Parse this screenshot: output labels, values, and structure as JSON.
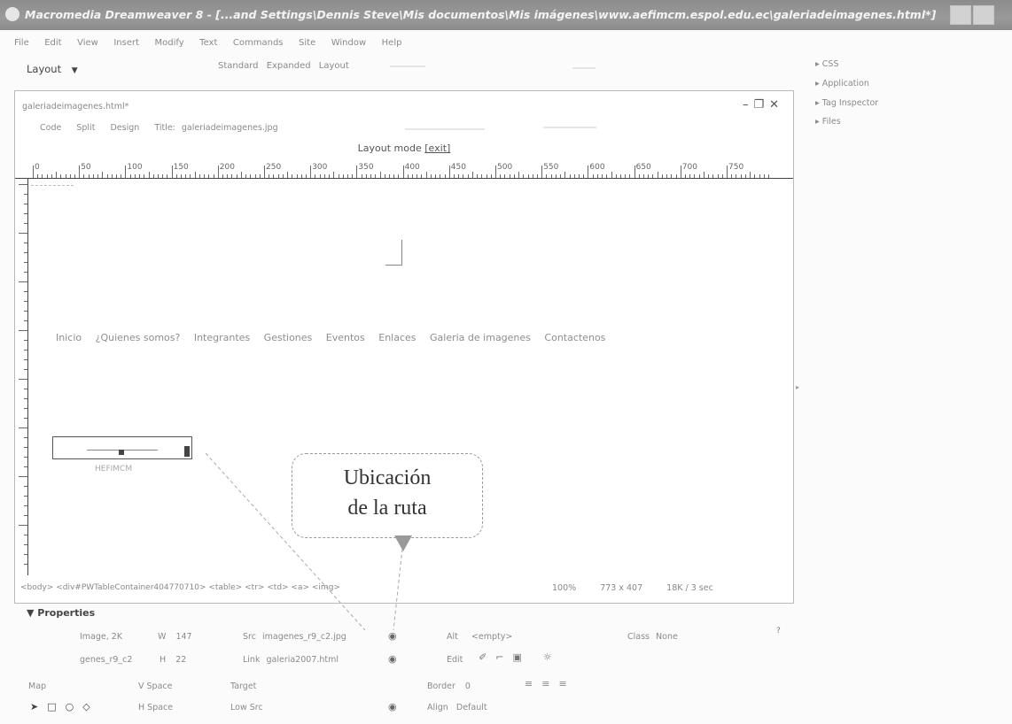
{
  "window": {
    "title": "Macromedia Dreamweaver 8 - [...and Settings\\Dennis Steve\\Mis documentos\\Mis imágenes\\www.aefimcm.espol.edu.ec\\galeriadeimagenes.html*]"
  },
  "menu": {
    "items": [
      "File",
      "Edit",
      "View",
      "Insert",
      "Modify",
      "Text",
      "Commands",
      "Site",
      "Window",
      "Help"
    ]
  },
  "toolbar": {
    "layout_dropdown": "Layout",
    "insert_tabs": [
      "Standard",
      "Expanded",
      "Layout"
    ]
  },
  "panels": {
    "items": [
      "CSS",
      "Application",
      "Tag Inspector",
      "Files"
    ]
  },
  "document": {
    "filename": "galeriadeimagenes.html*",
    "view_buttons": [
      "Code",
      "Split",
      "Design"
    ],
    "title_label": "Title:",
    "title_value": "galeriadeimagenes.jpg",
    "layout_mode_label": "Layout mode",
    "layout_mode_exit": "[exit]",
    "ruler_labels": [
      "0",
      "50",
      "100",
      "150",
      "200",
      "250",
      "300",
      "350",
      "400",
      "450",
      "500",
      "550",
      "600",
      "650",
      "700",
      "750"
    ],
    "nav_links": [
      "Inicio",
      "¿Quienes somos?",
      "Integrantes",
      "Gestiones",
      "Eventos",
      "Enlaces",
      "Galeria de imagenes",
      "Contactenos"
    ],
    "image_caption": "HEFIMCM",
    "callout": {
      "line1": "Ubicación",
      "line2": "de la ruta"
    },
    "tag_selector": "<body> <div#PWTableContainer404770710> <table> <tr> <td> <a> <img>",
    "zoom": "100%",
    "dimensions": "773 x 407",
    "filesize": "18K / 3 sec"
  },
  "properties": {
    "header": "Properties",
    "image_label": "Image, 2K",
    "image_name": "genes_r9_c2",
    "w_label": "W",
    "w_value": "147",
    "h_label": "H",
    "h_value": "22",
    "src_label": "Src",
    "src_value": "imagenes_r9_c2.jpg",
    "link_label": "Link",
    "link_value": "galeria2007.html",
    "alt_label": "Alt",
    "alt_value": "<empty>",
    "edit_label": "Edit",
    "class_label": "Class",
    "class_value": "None",
    "map_label": "Map",
    "vspace_label": "V Space",
    "hspace_label": "H Space",
    "target_label": "Target",
    "lowsrc_label": "Low Src",
    "border_label": "Border",
    "border_value": "0",
    "align_label": "Align",
    "align_value": "Default"
  }
}
